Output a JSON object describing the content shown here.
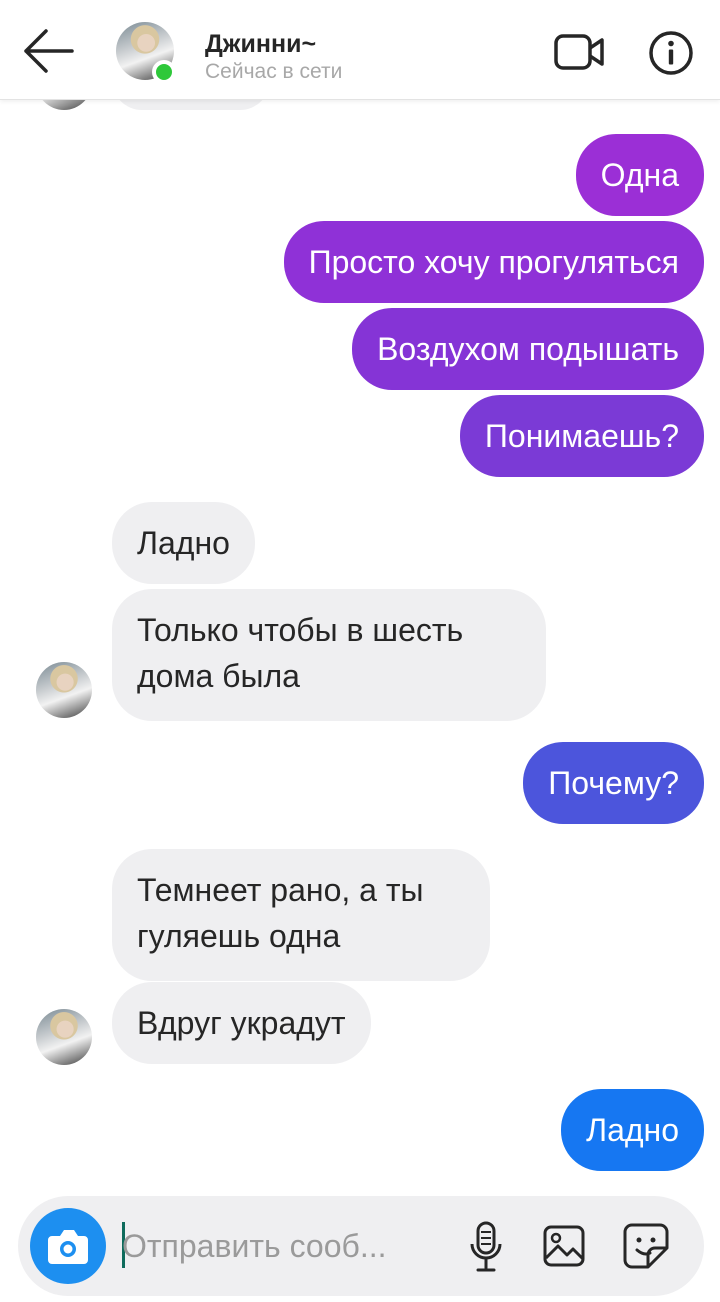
{
  "header": {
    "contact_name": "Джинни~",
    "status": "Сейчас в сети"
  },
  "messages": [
    {
      "from": "me",
      "text": "Одна"
    },
    {
      "from": "me",
      "text": "Просто хочу прогуляться"
    },
    {
      "from": "me",
      "text": "Воздухом подышать"
    },
    {
      "from": "me",
      "text": "Понимаешь?"
    },
    {
      "from": "them",
      "text": "Ладно"
    },
    {
      "from": "them",
      "text": "Только чтобы в шесть дома была"
    },
    {
      "from": "me",
      "text": "Почему?"
    },
    {
      "from": "them",
      "text": "Темнеет рано, а ты гуляешь одна"
    },
    {
      "from": "them",
      "text": "Вдруг украдут"
    },
    {
      "from": "me",
      "text": "Ладно"
    }
  ],
  "composer": {
    "placeholder": "Отправить сооб..."
  },
  "icons": {
    "back": "arrow-left-icon",
    "video": "video-camera-icon",
    "info": "info-icon",
    "camera": "camera-icon",
    "mic": "microphone-icon",
    "gallery": "image-icon",
    "sticker": "sticker-icon"
  },
  "colors": {
    "incoming_bubble": "#efeff1",
    "outgoing_top": "#9b2fd6",
    "outgoing_bottom": "#1677f2",
    "online": "#2ec83a",
    "camera_button": "#1d8ff0"
  }
}
